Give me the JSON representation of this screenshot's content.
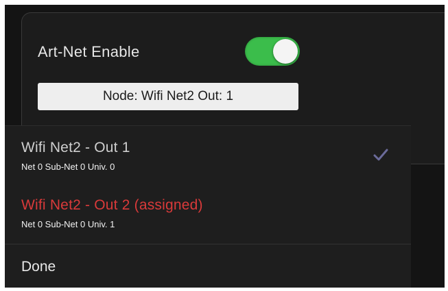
{
  "artnet": {
    "enable_label": "Art-Net Enable",
    "enabled": true,
    "node_button_label": "Node: Wifi Net2 Out: 1"
  },
  "picker": {
    "options": [
      {
        "title": "Wifi Net2 - Out 1",
        "subtitle": "Net 0  Sub-Net 0 Univ. 0",
        "selected": true,
        "color": "#cfcfcf"
      },
      {
        "title": "Wifi Net2 - Out 2 (assigned)",
        "subtitle": "Net 0  Sub-Net 0 Univ. 1",
        "selected": false,
        "color": "#d93a3a"
      }
    ],
    "done_label": "Done"
  },
  "colors": {
    "toggle_on": "#3bbd4b",
    "checkmark": "#6b6b9a",
    "assigned": "#d93a3a"
  },
  "icons": {
    "selected_indicator": "checkmark-icon"
  }
}
